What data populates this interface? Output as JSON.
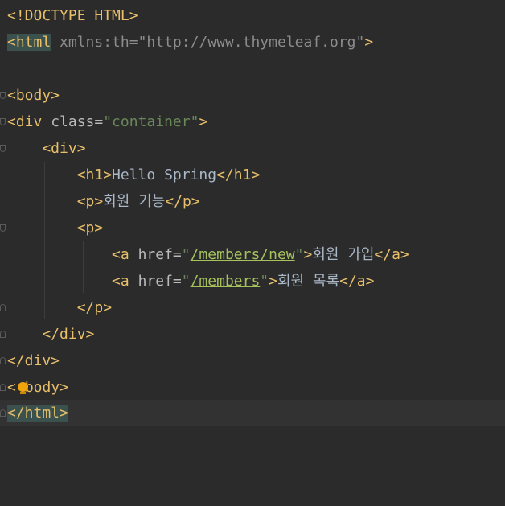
{
  "lines": [
    {
      "doctype": "<!DOCTYPE HTML>"
    },
    {
      "open": "<",
      "tag": "html",
      "attr": " xmlns:th=",
      "value": "\"http://www.thymeleaf.org\"",
      "close": ">"
    },
    {},
    {
      "text": "<body>"
    },
    {
      "tag_open": "<div ",
      "attr": "class=",
      "value": "\"container\"",
      "close": ">"
    },
    {
      "text": "    <div>"
    },
    {
      "text_a": "        <h1>",
      "plain": "Hello Spring",
      "text_b": "</h1>"
    },
    {
      "text_a": "        <p>",
      "plain": "회원 기능",
      "text_b": "</p>"
    },
    {
      "text": "        <p>"
    },
    {
      "tag_open": "            <a ",
      "attr": "href=",
      "q1": "\"",
      "link": "/members/new",
      "q2": "\"",
      "close": ">",
      "plain": "회원 가입",
      "end": "</a>"
    },
    {
      "tag_open": "            <a ",
      "attr": "href=",
      "q1": "\"",
      "link": "/members",
      "q2": "\"",
      "close": ">",
      "plain": "회원 목록",
      "end": "</a>"
    },
    {
      "text": "        </p>"
    },
    {
      "text": "    </div>"
    },
    {
      "text": "</div>"
    },
    {
      "text_a": "<",
      "text_b": "body>"
    },
    {
      "text": "</html>"
    }
  ],
  "icons": {
    "bulb": "lightbulb-icon"
  },
  "colors": {
    "background": "#2b2b2b",
    "tag": "#e8bf6a",
    "string": "#6a8759",
    "attribute": "#bababa",
    "text": "#a9b7c6"
  }
}
